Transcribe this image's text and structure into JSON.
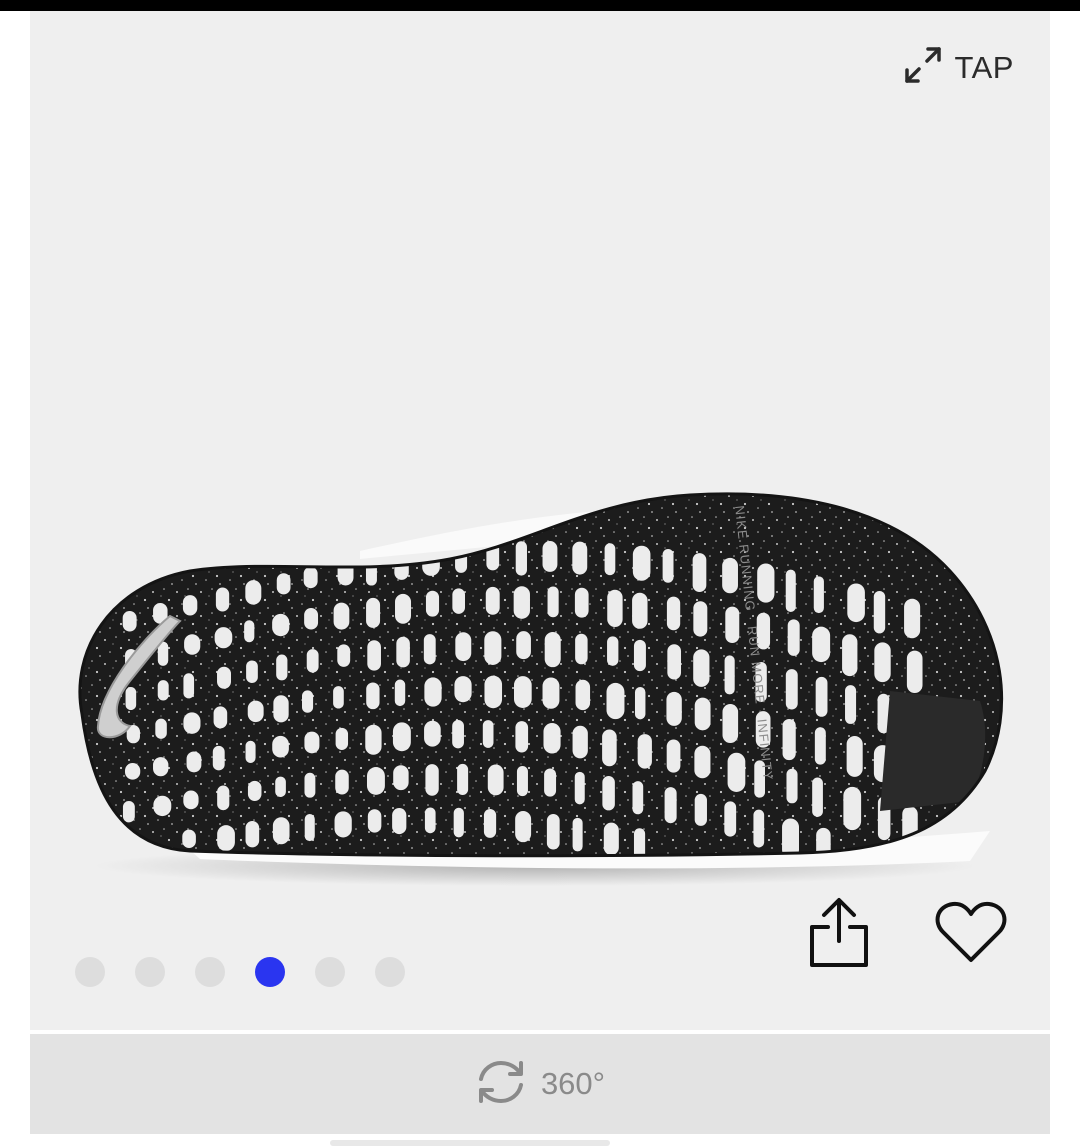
{
  "gallery": {
    "tap_label": "TAP",
    "tap_icon": "expand-arrows-icon",
    "image_alt": "Shoe outsole",
    "outsole_text": "NIKE RUNNING · RUN MORE · INFINITY",
    "share_icon": "share-icon",
    "favorite_icon": "heart-icon",
    "dots": [
      {
        "active": false
      },
      {
        "active": false
      },
      {
        "active": false
      },
      {
        "active": true
      },
      {
        "active": false
      },
      {
        "active": false
      }
    ],
    "active_dot_color": "#2a35f0",
    "inactive_dot_color": "#dddddd"
  },
  "view360": {
    "label": "360°",
    "icon": "rotate-icon"
  }
}
